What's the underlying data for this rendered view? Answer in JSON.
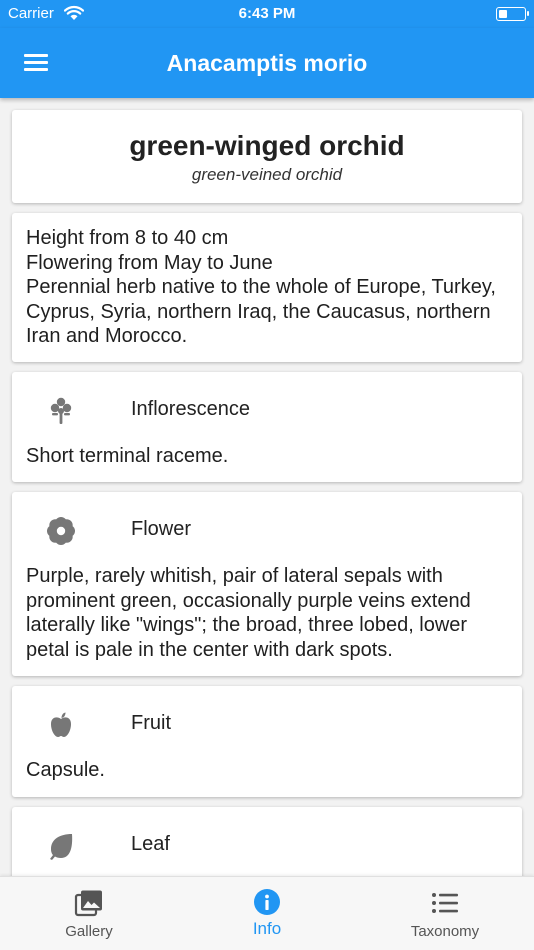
{
  "status": {
    "carrier": "Carrier",
    "time": "6:43 PM",
    "battery_level": 0.35
  },
  "app_bar": {
    "title": "Anacamptis morio"
  },
  "header": {
    "common_name": "green-winged orchid",
    "alt_name": "green-veined orchid"
  },
  "summary": {
    "lines": [
      "Height from 8 to 40 cm",
      "Flowering from May to June",
      "Perennial herb native to the whole of Europe, Turkey, Cyprus, Syria, northern Iraq, the Caucasus, northern Iran and Morocco."
    ]
  },
  "sections": [
    {
      "icon": "inflorescence-icon",
      "label": "Inflorescence",
      "text": "Short terminal raceme."
    },
    {
      "icon": "flower-icon",
      "label": "Flower",
      "text": "Purple, rarely whitish, pair of lateral sepals with prominent green, occasionally purple veins extend laterally like \"wings\"; the broad, three lobed, lower petal is pale in the center with dark spots."
    },
    {
      "icon": "apple-icon",
      "label": "Fruit",
      "text": "Capsule."
    },
    {
      "icon": "leaf-icon",
      "label": "Leaf",
      "text": ""
    }
  ],
  "bottom_nav": {
    "items": [
      {
        "label": "Gallery",
        "icon": "gallery-icon",
        "active": false
      },
      {
        "label": "Info",
        "icon": "info-icon",
        "active": true
      },
      {
        "label": "Taxonomy",
        "icon": "list-icon",
        "active": false
      }
    ]
  },
  "colors": {
    "primary": "#2196f3",
    "icon_gray": "#777777",
    "text": "#1f1f1f"
  }
}
